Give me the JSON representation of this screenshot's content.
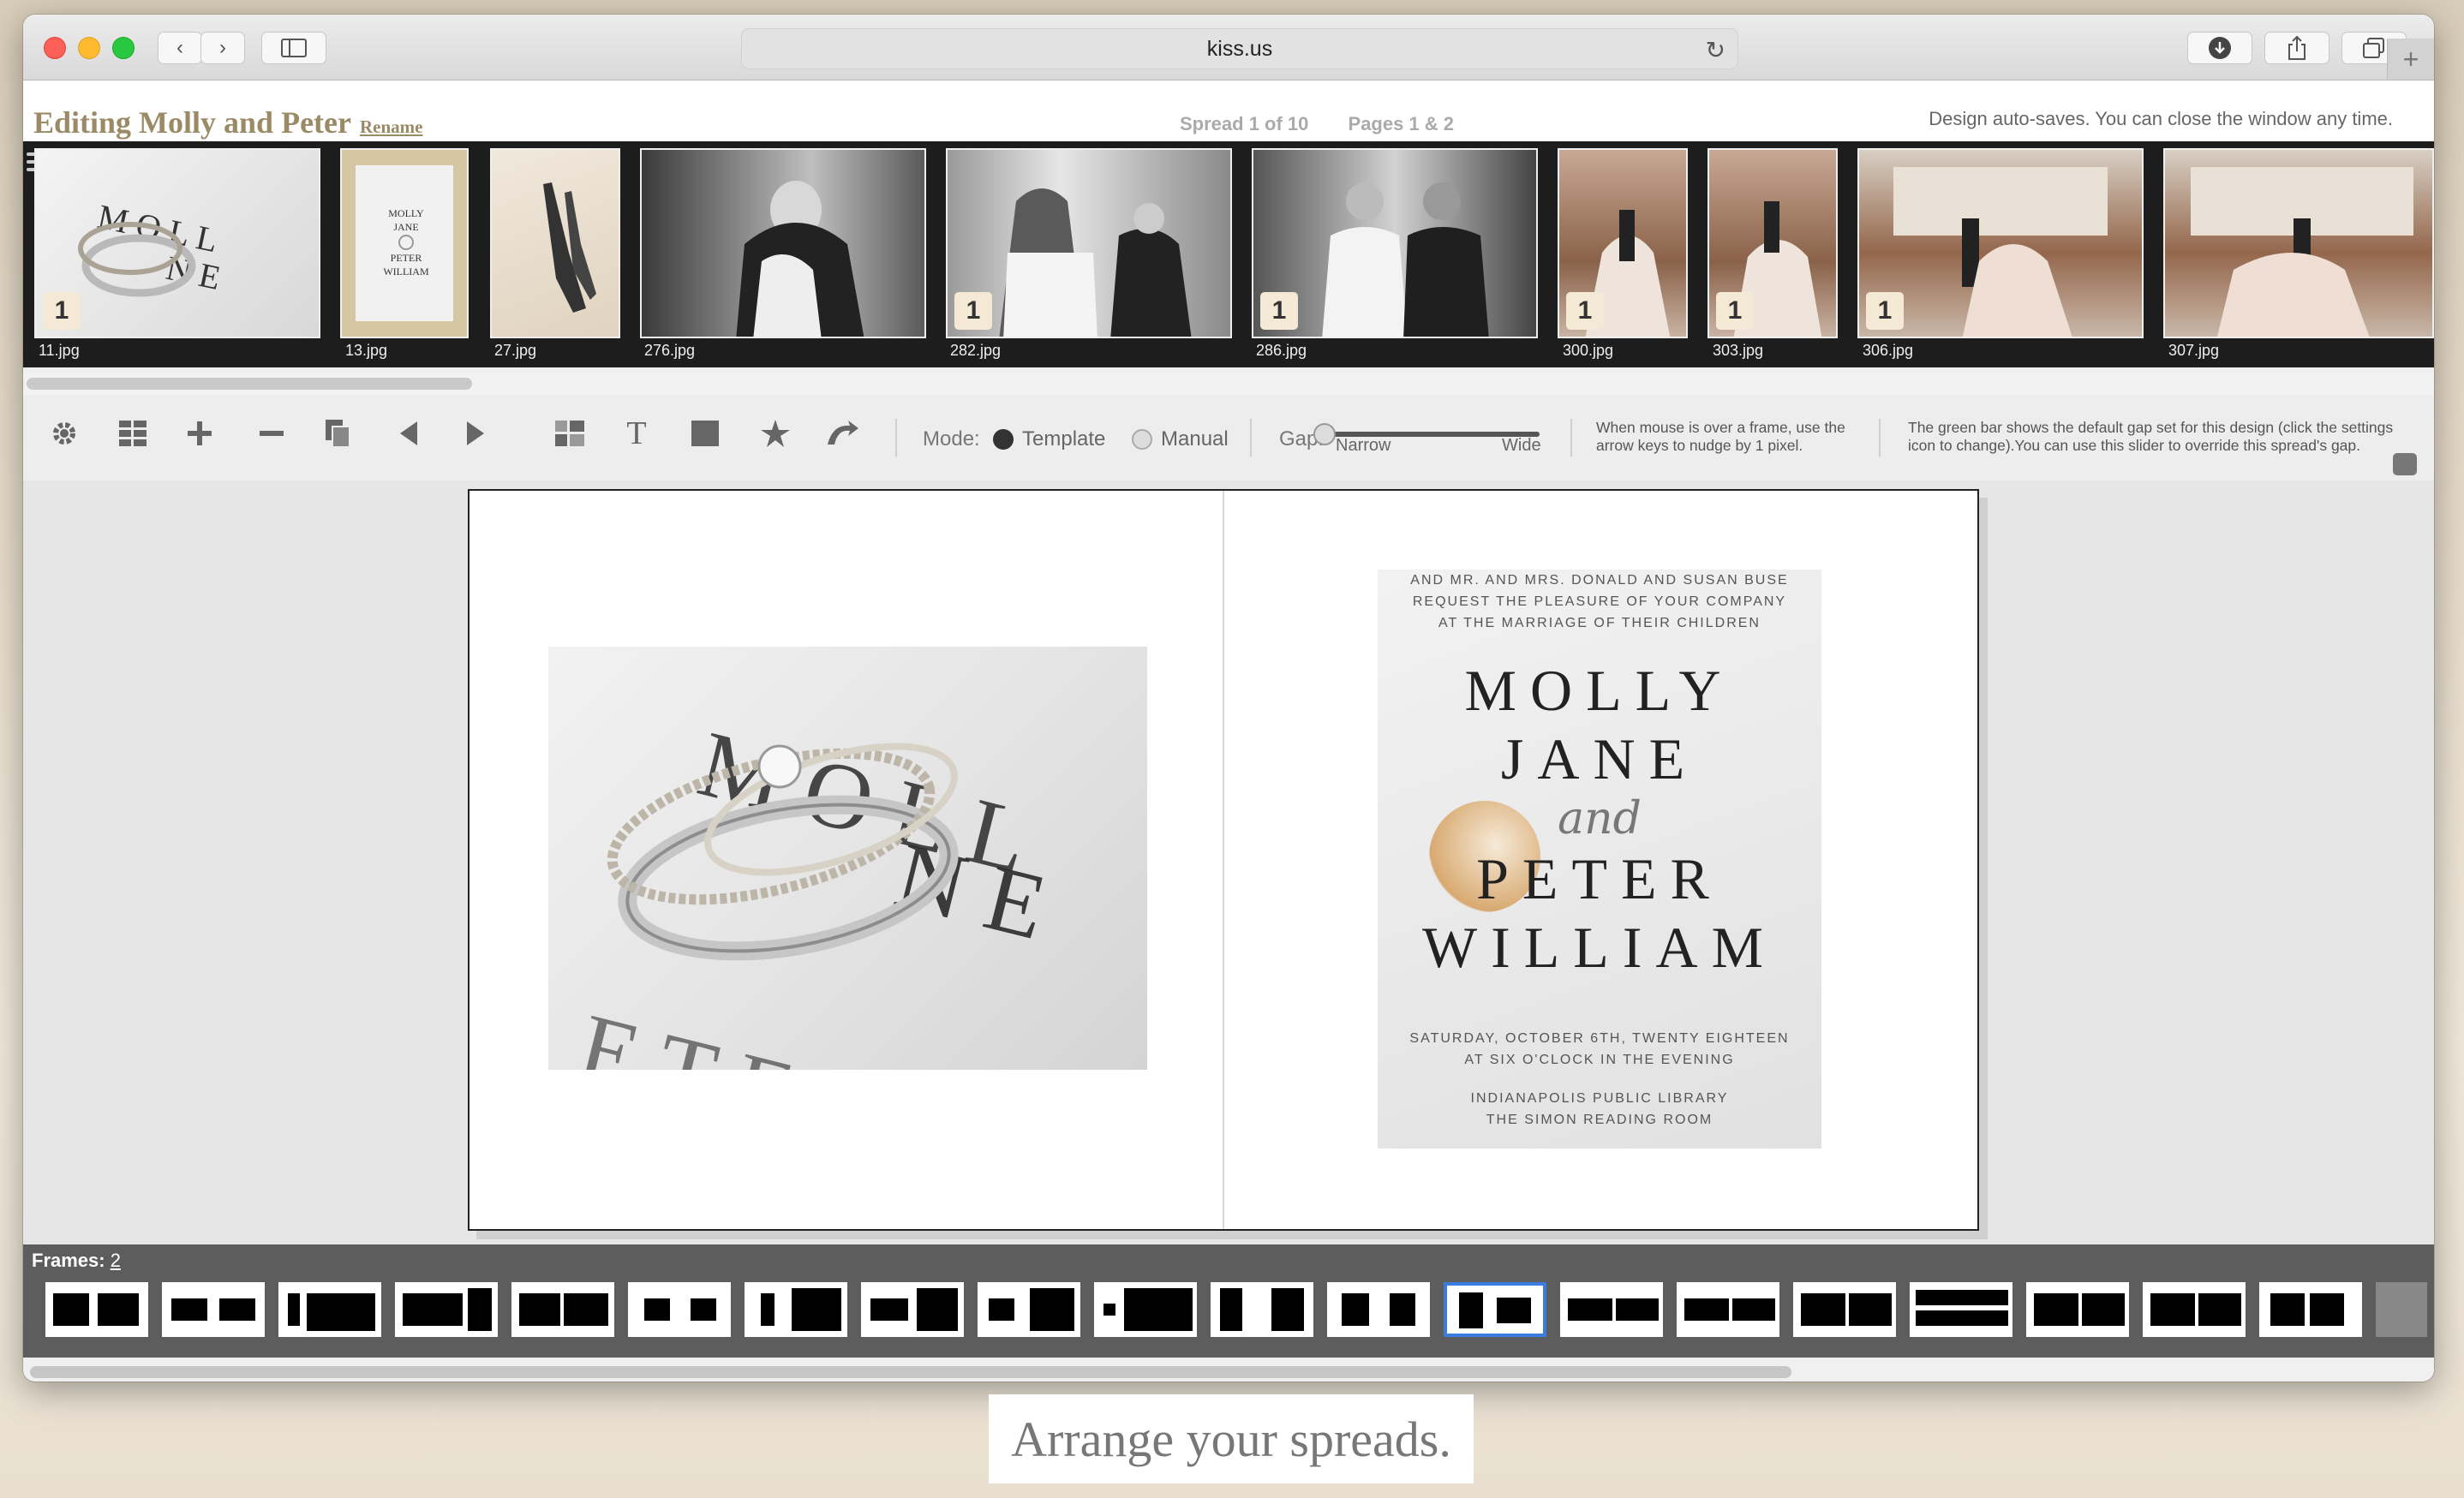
{
  "browser": {
    "url": "kiss.us",
    "back_icon": "‹",
    "forward_icon": "›"
  },
  "header": {
    "title": "Editing Molly and Peter",
    "rename_link": "Rename",
    "spread": "Spread 1 of 10",
    "pages": "Pages 1 & 2",
    "autosave": "Design auto-saves. You can close the window any time."
  },
  "thumbnails": [
    {
      "name": "11.jpg",
      "badge": "1"
    },
    {
      "name": "13.jpg",
      "badge": ""
    },
    {
      "name": "27.jpg",
      "badge": ""
    },
    {
      "name": "276.jpg",
      "badge": ""
    },
    {
      "name": "282.jpg",
      "badge": "1"
    },
    {
      "name": "286.jpg",
      "badge": "1"
    },
    {
      "name": "300.jpg",
      "badge": "1"
    },
    {
      "name": "303.jpg",
      "badge": "1"
    },
    {
      "name": "306.jpg",
      "badge": "1"
    },
    {
      "name": "307.jpg",
      "badge": ""
    }
  ],
  "toolbar": {
    "mode_label": "Mode:",
    "mode_template": "Template",
    "mode_manual": "Manual",
    "gap_label": "Gap:",
    "gap_narrow": "Narrow",
    "gap_wide": "Wide",
    "hint_nudge": "When mouse is over a frame, use the arrow keys to nudge by 1 pixel.",
    "hint_gap": "The green bar shows the default gap set for this design (click the settings icon to change).You can use this slider to override this spread's gap.",
    "text_tool": "T"
  },
  "invitation": {
    "line1": "AND MR. AND MRS. DONALD AND SUSAN BUSE",
    "line2": "REQUEST THE PLEASURE OF YOUR COMPANY",
    "line3": "AT THE MARRIAGE OF THEIR CHILDREN",
    "name1": "MOLLY",
    "name2": "JANE",
    "and": "and",
    "name3": "PETER",
    "name4": "WILLIAM",
    "date1": "SATURDAY, OCTOBER 6TH, TWENTY EIGHTEEN",
    "date2": "AT SIX O'CLOCK IN THE EVENING",
    "venue1": "INDIANAPOLIS PUBLIC LIBRARY",
    "venue2": "THE SIMON READING ROOM"
  },
  "photo_left_letters": "MOLL NE ETE",
  "layouts": {
    "frames_label": "Frames:",
    "frames_count": "2",
    "selected_index": 12
  },
  "caption": "Arrange your spreads."
}
